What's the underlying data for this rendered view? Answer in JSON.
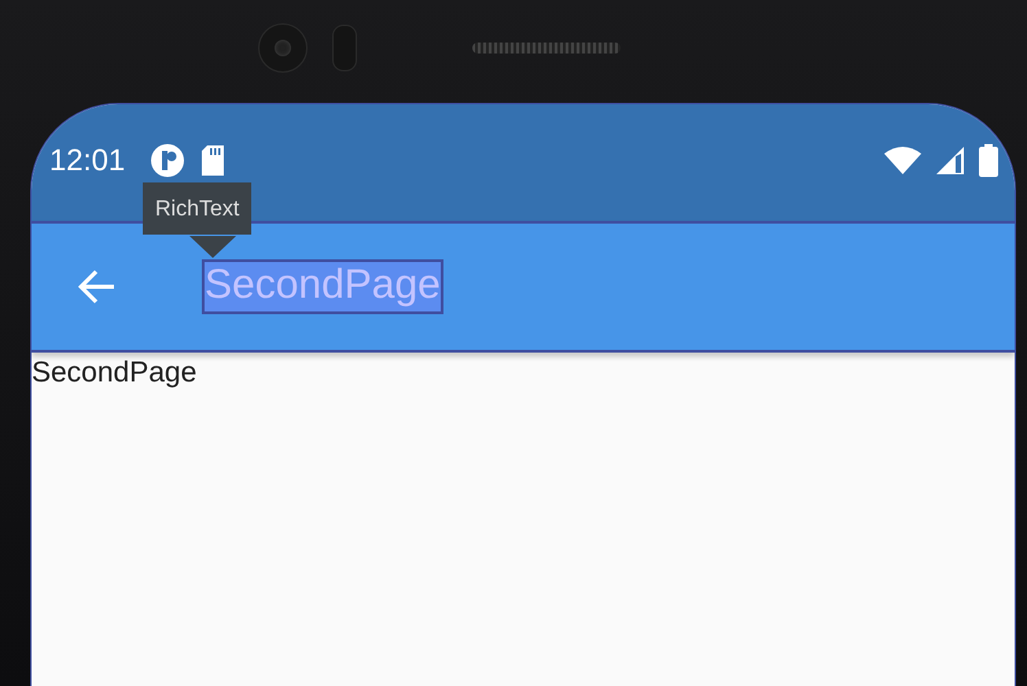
{
  "status_bar": {
    "time": "12:01"
  },
  "app_bar": {
    "title": "SecondPage"
  },
  "body": {
    "text": "SecondPage"
  },
  "inspector": {
    "tooltip": "RichText"
  }
}
